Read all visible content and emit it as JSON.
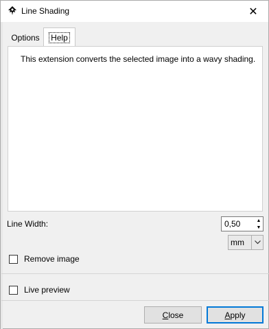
{
  "window": {
    "title": "Line Shading",
    "close_glyph": "✕"
  },
  "tabs": [
    {
      "label": "Options",
      "active": false
    },
    {
      "label": "Help",
      "active": true
    }
  ],
  "help": {
    "text": "This extension converts the selected image into a wavy shading."
  },
  "line_width": {
    "label": "Line Width:",
    "value": "0,50",
    "unit": "mm"
  },
  "options": {
    "remove_image_label": "Remove image",
    "remove_image_checked": false,
    "live_preview_label": "Live preview",
    "live_preview_checked": false
  },
  "buttons": {
    "close_mnemonic": "C",
    "close_rest": "lose",
    "apply_mnemonic": "A",
    "apply_rest": "pply"
  },
  "colors": {
    "accent": "#0078d7",
    "panel": "#ffffff",
    "background": "#f0f0f0"
  }
}
